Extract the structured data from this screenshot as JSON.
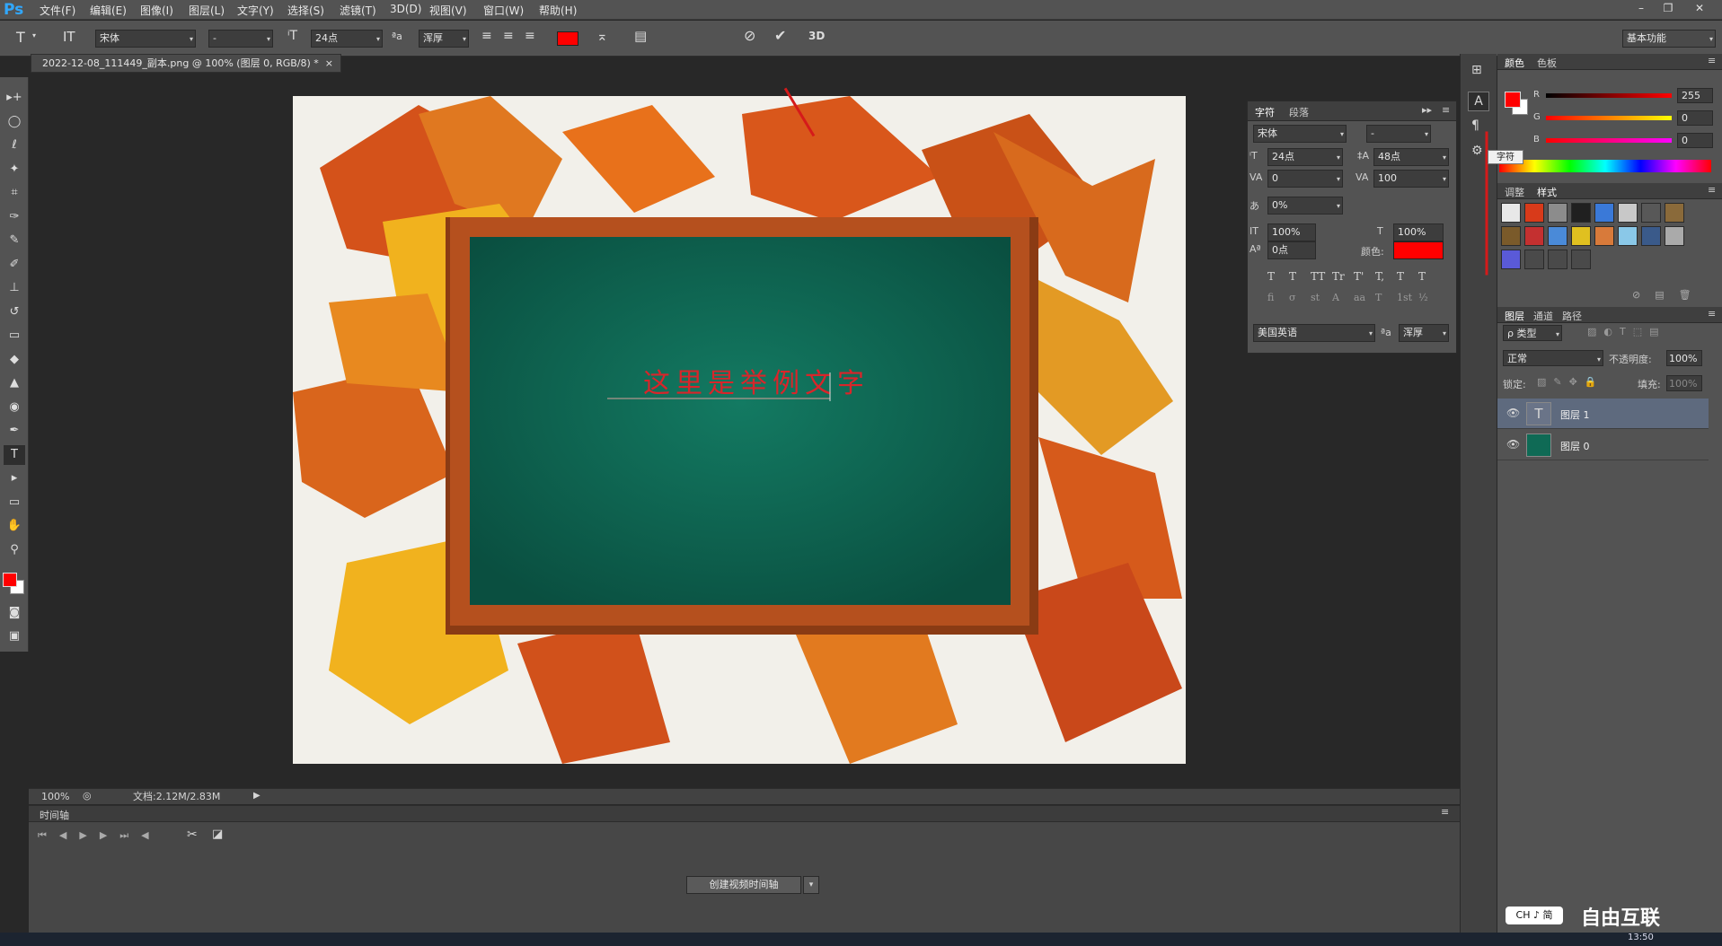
{
  "app": {
    "logo": "Ps",
    "menus": [
      "文件(F)",
      "编辑(E)",
      "图像(I)",
      "图层(L)",
      "文字(Y)",
      "选择(S)",
      "滤镜(T)",
      "3D(D)",
      "视图(V)",
      "窗口(W)",
      "帮助(H)"
    ],
    "window_controls": [
      "–",
      "❐",
      "✕"
    ]
  },
  "options": {
    "font_family": "宋体",
    "font_style": "-",
    "font_size": "24点",
    "aa_label": "ªa",
    "aa_mode": "浑厚",
    "text_color": "#ff0000",
    "commit_icon": "check-icon",
    "cancel_icon": "cancel-icon",
    "three_d": "3D",
    "workspace": "基本功能"
  },
  "document": {
    "tab_title": "2022-12-08_111449_副本.png @ 100% (图层 0, RGB/8) *",
    "close": "×",
    "text_layer": "这里是举例文字",
    "text_color": "#d9252a",
    "bg_color": "#f2f0ea",
    "board_color": "#0f6a55",
    "frame_color": "#b5501e"
  },
  "status": {
    "zoom": "100%",
    "doc_info": "文档:2.12M/2.83M"
  },
  "timeline": {
    "title": "时间轴",
    "create_button": "创建视频时间轴"
  },
  "character_panel": {
    "tabs": [
      "字符",
      "段落"
    ],
    "font_family": "宋体",
    "font_style": "-",
    "size": "24点",
    "leading": "48点",
    "kerning": "0",
    "tracking": "100",
    "scale_pct": "0%",
    "vert_scale": "100%",
    "horz_scale": "100%",
    "baseline": "0点",
    "color_label": "颜色:",
    "color": "#ff0000",
    "styles": [
      "T",
      "T",
      "TT",
      "Tr",
      "T'",
      "T,",
      "T",
      "T"
    ],
    "opentype": [
      "fi",
      "σ",
      "st",
      "A",
      "aa",
      "T",
      "1st",
      "½"
    ],
    "language": "美国英语",
    "aa_label": "ªa",
    "aa_mode": "浑厚"
  },
  "dock": {
    "tooltip": "字符"
  },
  "color_panel": {
    "tabs": [
      "颜色",
      "色板"
    ],
    "channels": [
      {
        "label": "R",
        "value": "255"
      },
      {
        "label": "G",
        "value": "0"
      },
      {
        "label": "B",
        "value": "0"
      }
    ],
    "fg": "#ff0000"
  },
  "styles_panel": {
    "tabs": [
      "调整",
      "样式"
    ]
  },
  "layers_panel": {
    "tabs": [
      "图层",
      "通道",
      "路径"
    ],
    "filter": "ρ 类型",
    "blend_mode": "正常",
    "opacity_label": "不透明度:",
    "opacity": "100%",
    "lock_label": "锁定:",
    "fill_label": "填充:",
    "fill": "100%",
    "layers": [
      {
        "name": "图层 1",
        "type": "T",
        "selected": true
      },
      {
        "name": "图层 0",
        "type": "img",
        "selected": false
      }
    ]
  },
  "taskbar": {
    "ime": "CH ♪ 简",
    "time": "13:50",
    "watermark": "自由互联"
  }
}
